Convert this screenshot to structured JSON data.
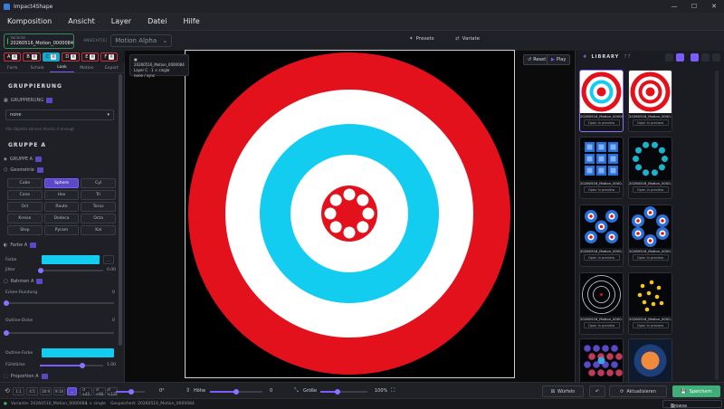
{
  "window": {
    "title": "Impact4Shape",
    "controls": [
      "—",
      "☐",
      "✕"
    ]
  },
  "menu": [
    "Komposition",
    "Ansicht",
    "Layer",
    "Datei",
    "Hilfe"
  ],
  "variant_box": {
    "sub": "Variante",
    "value": "20260516_Motion_0000084"
  },
  "ansicht": {
    "label": "ANSICHT(E)",
    "value": "Motion Alpha"
  },
  "toolbar": {
    "presets": "Presets",
    "variate": "Variate"
  },
  "abc": [
    {
      "label": "A",
      "key": "R"
    },
    {
      "label": "B",
      "key": "R"
    },
    {
      "label": "C",
      "key": "R"
    },
    {
      "label": "D",
      "key": "R"
    },
    {
      "label": "E",
      "key": "R"
    },
    {
      "label": "F",
      "key": "R"
    }
  ],
  "left": {
    "tabs": [
      "Form",
      "Schale",
      "Look",
      "Motion",
      "Export"
    ],
    "active_tab": 2,
    "gruppierung_title": "GRUPPIERUNG",
    "gruppierung_label": "GRUPPIERUNG",
    "gruppierung_value": "none",
    "gruppierung_hint": "Alle Objekte können Atomic A erzeugt",
    "gruppe_title": "GRUPPE A",
    "gruppe_sub": "GRUPPE A",
    "geometrie": "Geometrie",
    "geometries": [
      "Cube",
      "Sphere",
      "Cyl",
      "Cone",
      "Hex",
      "Tri",
      "Oct",
      "Raute",
      "Torus",
      "Kreise",
      "Dodeca",
      "Octa",
      "Step",
      "Pyram",
      "Kal"
    ],
    "active_geometry": 1,
    "farbe_section": "Farbe A",
    "farbe_label": "Farbe",
    "farbe_color": "#12cdf0",
    "farbe_btn": "...",
    "jitter_label": "Jitter",
    "jitter_value": "0.00",
    "rahmen_section": "Rahmen A",
    "ecken_label": "Ecken-Rundung",
    "ecken_value": "0",
    "outline_dicke_label": "Outline-Dicke",
    "outline_dicke_value": "0",
    "outline_farbe_label": "Outline-Farbe",
    "outline_farbe_color": "#12cdf0",
    "fuellstaerke_label": "Füllstärke",
    "fuellstaerke_value": "1.00",
    "proportion_section": "Proportion A"
  },
  "layer_info": {
    "name": "20260516_Motion_0000084",
    "layer": "Layer C",
    "mode": "1 × single",
    "extra": "none / sync"
  },
  "canvas_btns": {
    "reset": "Reset",
    "play": "Play"
  },
  "target": {
    "colors": [
      "#e2111b",
      "#ffffff",
      "#12cdf0",
      "#ffffff",
      "#e2111b"
    ]
  },
  "library": {
    "title": "LIBRARY",
    "count": "77",
    "open_label": "Open in preview",
    "items": [
      {
        "name": "20260516_Motion_0000084",
        "kind": "target-cyan",
        "selected": true
      },
      {
        "name": "20260516_Motion_0000...",
        "kind": "target-red",
        "selected": false
      },
      {
        "name": "20260516_Motion_0000...",
        "kind": "squares",
        "selected": false
      },
      {
        "name": "20260516_Motion_0000...",
        "kind": "ring-dots",
        "selected": false
      },
      {
        "name": "20260516_Motion_0000...",
        "kind": "target-grid",
        "selected": false
      },
      {
        "name": "20260516_Motion_0000...",
        "kind": "target-ring",
        "selected": false
      },
      {
        "name": "20260516_Motion_0000...",
        "kind": "concentric",
        "selected": false
      },
      {
        "name": "20260516_Motion_0000...",
        "kind": "yellow-dots",
        "selected": false
      },
      {
        "name": "",
        "kind": "hex-dots",
        "selected": false
      },
      {
        "name": "",
        "kind": "orange-circle",
        "selected": false
      }
    ]
  },
  "bottom": {
    "ratios": [
      "1:1",
      "4:5",
      "16:9",
      "9:16",
      "...",
      "↺ +45",
      "↺ +90",
      "↺ +135",
      "↺ +180"
    ],
    "hoehe_label": "Höhe",
    "hoehe_value": "0",
    "groesse_label": "Größe",
    "groesse_value": "100%",
    "wuerfeln": "Würfeln",
    "aktualisieren": "Aktualisieren",
    "speichern": "Speichern"
  },
  "status": {
    "variante": "Variante: 20260516_Motion_0000084",
    "mode": "1 × single",
    "saved": "Gespeichert: 20260516_Motion_0000084",
    "browse": "Browse"
  }
}
